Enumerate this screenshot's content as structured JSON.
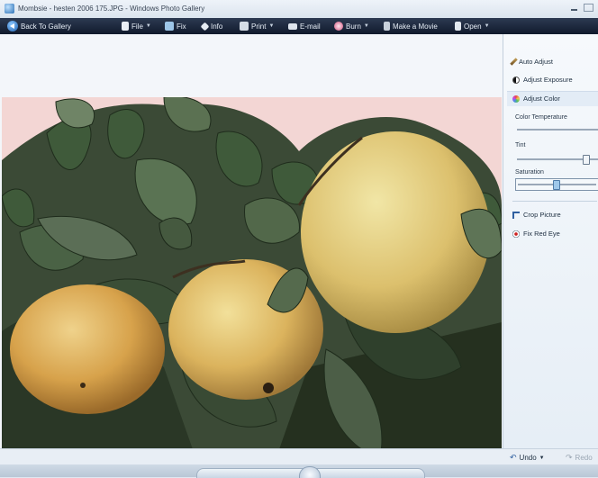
{
  "window": {
    "title": "Mombsie - hesten 2006 175.JPG - Windows Photo Gallery"
  },
  "toolbar": {
    "back_label": "Back To Gallery",
    "file_label": "File",
    "fix_label": "Fix",
    "info_label": "Info",
    "print_label": "Print",
    "email_label": "E-mail",
    "burn_label": "Burn",
    "movie_label": "Make a Movie",
    "open_label": "Open"
  },
  "fix_pane": {
    "auto_adjust": "Auto Adjust",
    "adjust_exposure": "Adjust Exposure",
    "adjust_color": "Adjust Color",
    "color_temperature": "Color Temperature",
    "tint": "Tint",
    "saturation": "Saturation",
    "crop_picture": "Crop Picture",
    "fix_red_eye": "Fix Red Eye",
    "tint_level": 0.85,
    "saturation_level": 0.5
  },
  "bottom": {
    "undo_label": "Undo",
    "redo_label": "Redo"
  },
  "colors": {
    "photo_background": "#f4d8d8",
    "orange": "#d8a24a",
    "leaf_dark": "#2c3f2a"
  }
}
